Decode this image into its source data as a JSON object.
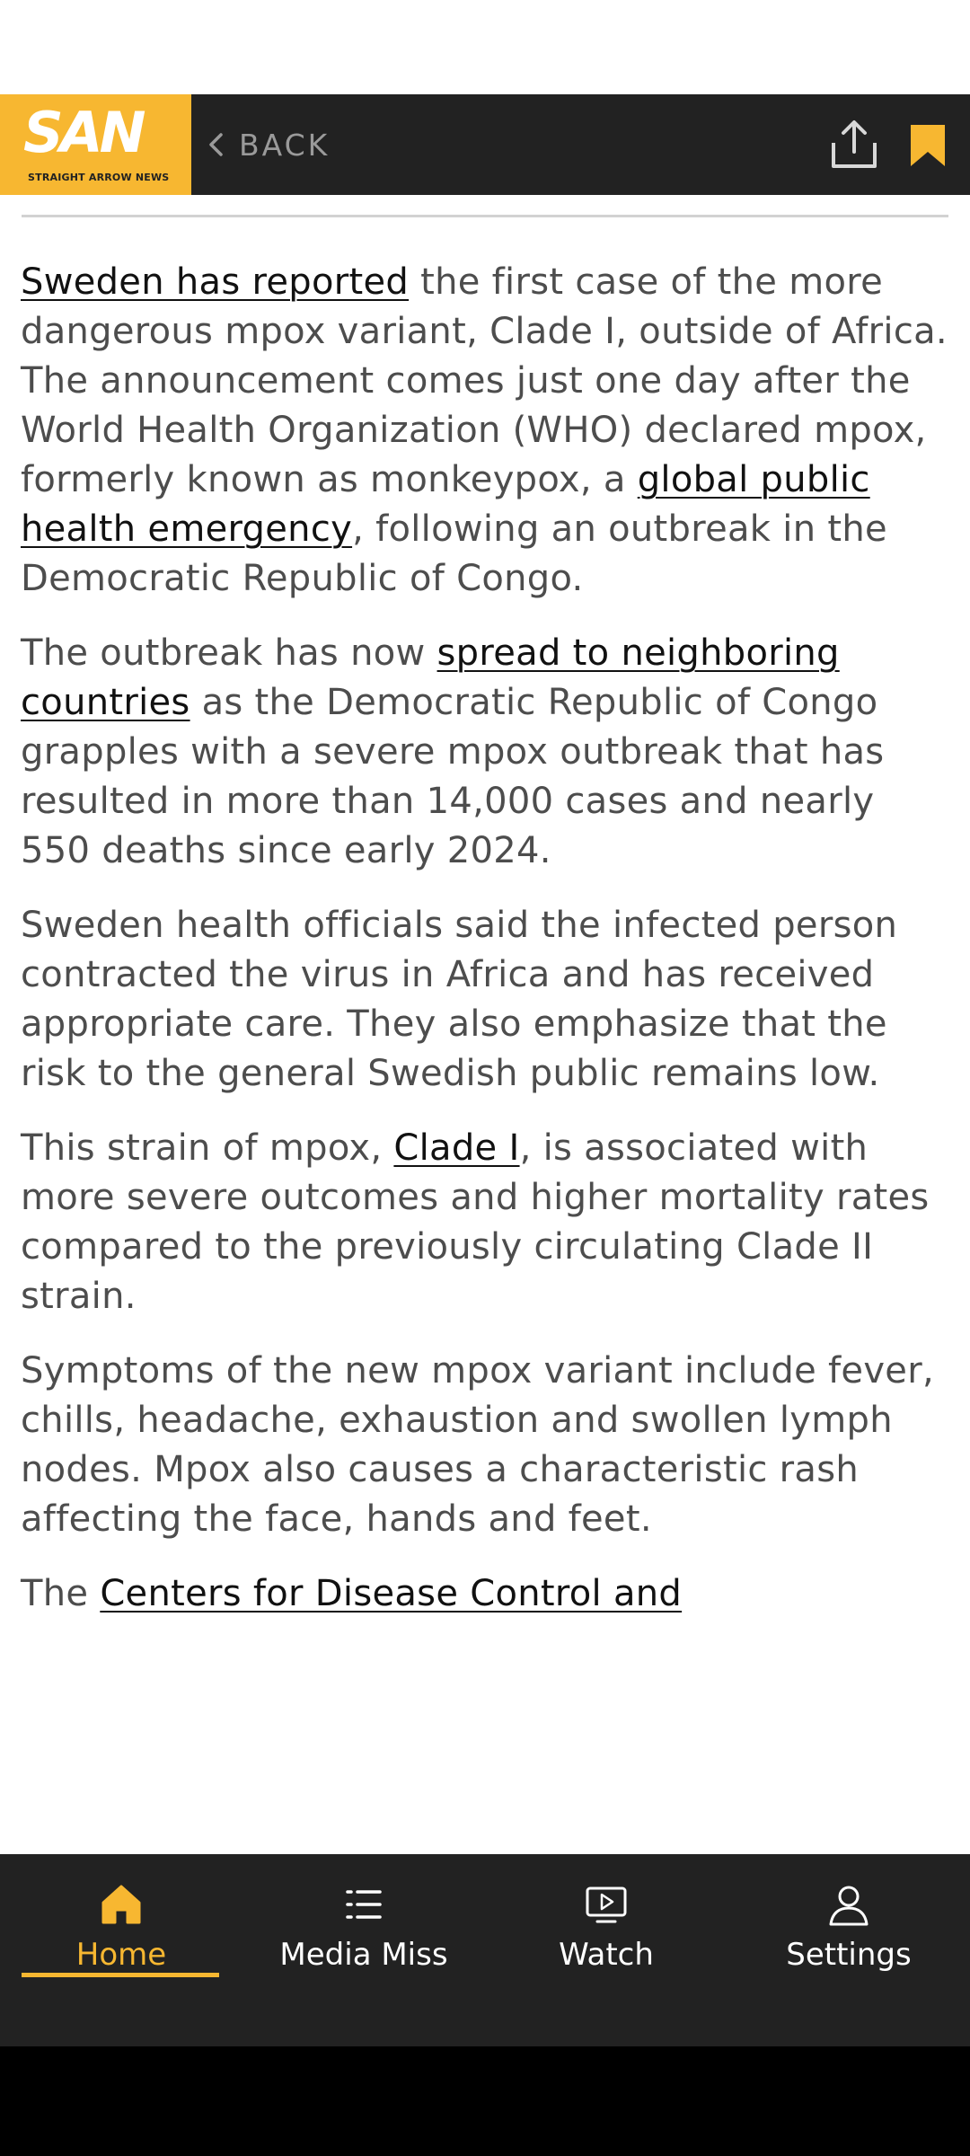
{
  "header": {
    "logo_text": "SAN",
    "logo_subtitle": "STRAIGHT ARROW NEWS",
    "back_label": "BACK",
    "share_icon": "share-icon",
    "bookmark_icon": "bookmark-icon"
  },
  "colors": {
    "accent": "#f7b731",
    "bar_background": "#222222",
    "body_text": "#4d4d4d",
    "link_text": "#111111"
  },
  "article": {
    "p1": {
      "link1": "Sweden has reported",
      "text1": " the first case of the more dangerous mpox variant, Clade I, outside of Africa. The announcement comes just one day after the World Health Organization (WHO) declared mpox, formerly known as monkeypox, a ",
      "link2": "global public health emergency",
      "text2": ", following an outbreak in the Democratic Republic of Congo."
    },
    "p2": {
      "text1": "The outbreak has now ",
      "link1": "spread to neighboring countries",
      "text2": " as the Democratic Republic of Congo grapples with a severe mpox outbreak that has resulted in more than 14,000 cases and nearly 550 deaths since early 2024."
    },
    "p3": {
      "text1": "Sweden health officials said the infected person contracted the virus in Africa and has received appropriate care. They also emphasize that the risk to the general Swedish public remains low."
    },
    "p4": {
      "text1": "This strain of mpox, ",
      "link1": "Clade I",
      "text2": ", is associated with more severe outcomes and higher mortality rates compared to the previously circulating Clade II strain."
    },
    "p5": {
      "text1": "Symptoms of the new mpox variant include fever, chills, headache, exhaustion and swollen lymph nodes. Mpox also causes a characteristic rash affecting the face, hands and feet."
    },
    "p6": {
      "text1": "The ",
      "link1": "Centers for Disease Control and"
    }
  },
  "bottom_nav": {
    "tabs": [
      {
        "label": "Home",
        "icon": "home-icon",
        "active": true
      },
      {
        "label": "Media Miss",
        "icon": "list-icon",
        "active": false
      },
      {
        "label": "Watch",
        "icon": "play-icon",
        "active": false
      },
      {
        "label": "Settings",
        "icon": "person-icon",
        "active": false
      }
    ]
  }
}
